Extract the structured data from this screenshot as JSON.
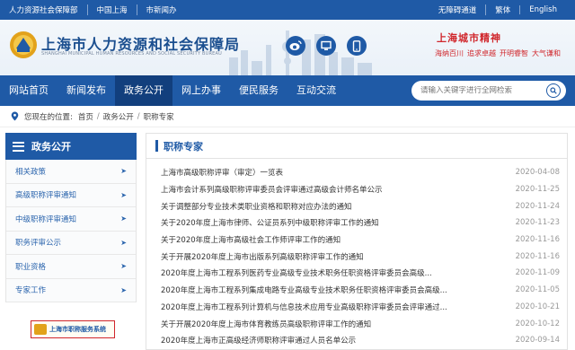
{
  "topbar": {
    "left": [
      "人力资源社会保障部",
      "中国上海",
      "市新闻办"
    ],
    "right": [
      "无障碍通道",
      "繁体",
      "English"
    ]
  },
  "header": {
    "title": "上海市人力资源和社会保障局",
    "subtitle": "SHANGHAI MUNICIPAL HUMAN RESOURCES AND SOCIAL SECURITY BUREAU",
    "social_icons": [
      "weibo-icon",
      "monitor-icon",
      "mobile-icon"
    ],
    "spirit_title": "上海城市精神",
    "spirit_items": [
      "海纳百川",
      "追求卓越",
      "开明睿智",
      "大气谦和"
    ]
  },
  "nav": {
    "items": [
      "网站首页",
      "新闻发布",
      "政务公开",
      "网上办事",
      "便民服务",
      "互动交流"
    ],
    "active_index": 2,
    "search_placeholder": "请输入关键字进行全网检索"
  },
  "breadcrumb": {
    "prefix": "您现在的位置:",
    "path": [
      "首页",
      "政务公开",
      "职称专家"
    ]
  },
  "sidebar": {
    "title": "政务公开",
    "items": [
      "相关政策",
      "高级职称评审通知",
      "中级职称评审通知",
      "职务评审公示",
      "职业资格",
      "专家工作"
    ],
    "banner": "上海市职称服务系统"
  },
  "content": {
    "title": "职称专家",
    "articles": [
      {
        "title": "上海市高级职称评审（审定）一览表",
        "date": "2020-04-08"
      },
      {
        "title": "上海市会计系列高级职称评审委员会评审通过高级会计师名单公示",
        "date": "2020-11-25"
      },
      {
        "title": "关于调整部分专业技术类职业资格和职称对应办法的通知",
        "date": "2020-11-24"
      },
      {
        "title": "关于2020年度上海市律师、公证员系列中级职称评审工作的通知",
        "date": "2020-11-23"
      },
      {
        "title": "关于2020年度上海市高级社会工作师评审工作的通知",
        "date": "2020-11-16"
      },
      {
        "title": "关于开展2020年度上海市出版系列高级职称评审工作的通知",
        "date": "2020-11-16"
      },
      {
        "title": "2020年度上海市工程系列医药专业高级专业技术职务任职资格评审委员会高级...",
        "date": "2020-11-09"
      },
      {
        "title": "2020年度上海市工程系列集成电路专业高级专业技术职务任职资格评审委员会高级...",
        "date": "2020-11-05"
      },
      {
        "title": "2020年度上海市工程系列计算机与信息技术应用专业高级职称评审委员会评审通过...",
        "date": "2020-10-21"
      },
      {
        "title": "关于开展2020年度上海市体育教练员高级职称评审工作的通知",
        "date": "2020-10-12"
      },
      {
        "title": "2020年度上海市正高级经济师职称评审通过人员名单公示",
        "date": "2020-09-14"
      }
    ]
  },
  "colors": {
    "primary": "#1f5aa6",
    "active_nav": "#123f7d",
    "spirit_red": "#d0262b"
  }
}
